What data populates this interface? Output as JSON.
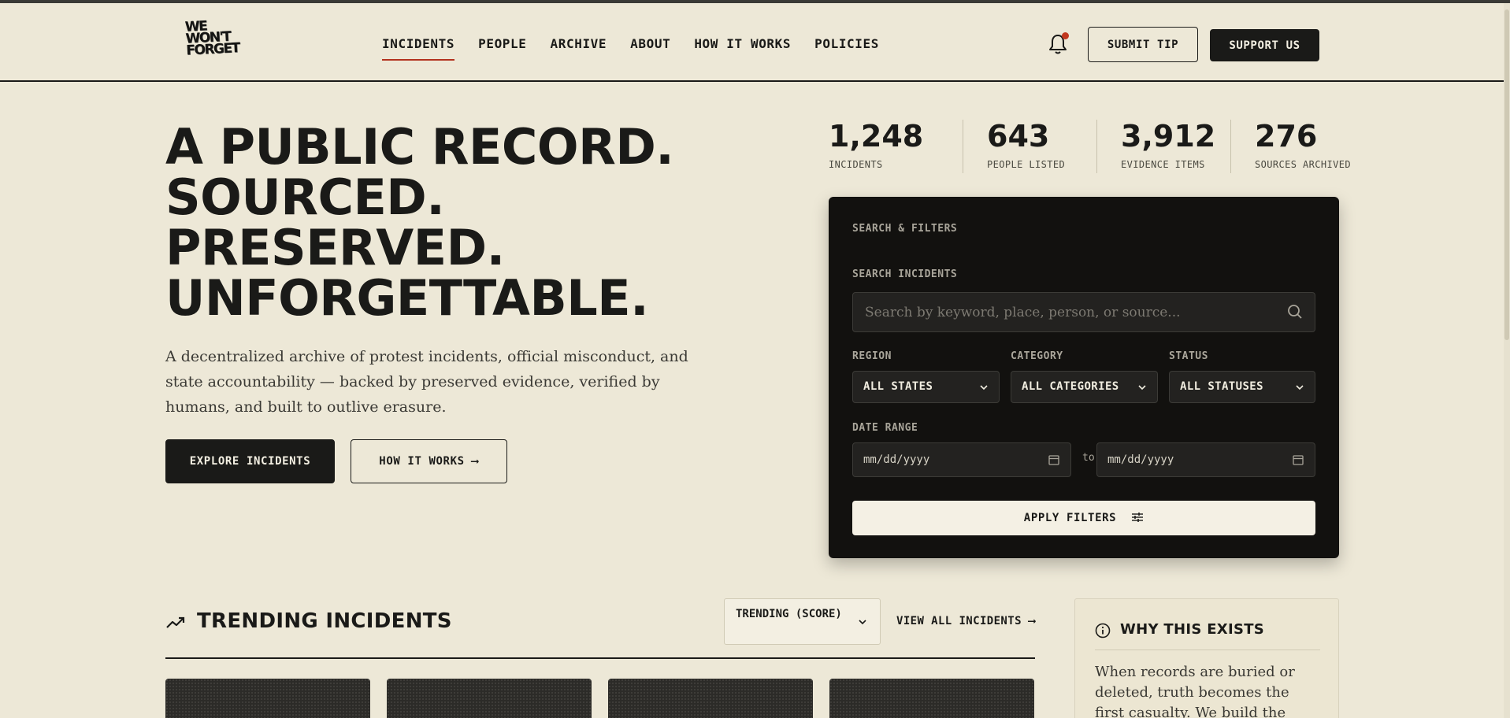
{
  "brand": {
    "logo_text": "WE WON'T FORGET"
  },
  "nav": {
    "items": [
      {
        "label": "INCIDENTS",
        "active": true
      },
      {
        "label": "PEOPLE"
      },
      {
        "label": "ARCHIVE"
      },
      {
        "label": "ABOUT"
      },
      {
        "label": "HOW IT WORKS"
      },
      {
        "label": "POLICIES"
      }
    ]
  },
  "header": {
    "notifications_icon": "bell-icon",
    "submit_tip_label": "SUBMIT TIP",
    "support_label": "SUPPORT US"
  },
  "hero": {
    "title_lines": [
      "A PUBLIC RECORD.",
      "SOURCED.",
      "PRESERVED.",
      "UNFORGETTABLE."
    ],
    "description": "A decentralized archive of protest incidents, official misconduct, and state accountability — backed by preserved evidence, verified by humans, and built to outlive erasure.",
    "explore_label": "EXPLORE INCIDENTS",
    "how_label": "HOW IT WORKS ⟶"
  },
  "stats": [
    {
      "value": "1,248",
      "label": "INCIDENTS"
    },
    {
      "value": "643",
      "label": "PEOPLE LISTED"
    },
    {
      "value": "3,912",
      "label": "EVIDENCE ITEMS"
    },
    {
      "value": "276",
      "label": "SOURCES ARCHIVED"
    }
  ],
  "filters": {
    "title": "SEARCH & FILTERS",
    "search_label": "SEARCH INCIDENTS",
    "search_placeholder": "Search by keyword, place, person, or source...",
    "region_label": "REGION",
    "region_value": "ALL STATES",
    "category_label": "CATEGORY",
    "category_value": "ALL CATEGORIES",
    "status_label": "STATUS",
    "status_value": "ALL STATUSES",
    "date_label": "DATE RANGE",
    "date_from": "mm/dd/yyyy",
    "date_to": "mm/dd/yyyy",
    "to_text": "to",
    "apply_label": "APPLY FILTERS"
  },
  "trending": {
    "title": "TRENDING INCIDENTS",
    "sort_value": "TRENDING (SCORE)",
    "view_all_label": "VIEW ALL INCIDENTS ⟶"
  },
  "why": {
    "title": "WHY THIS EXISTS",
    "text": "When records are buried or deleted, truth becomes the first casualty. We build the memory"
  },
  "colors": {
    "background": "#EDE8D7",
    "ink": "#1a1a18",
    "accent": "#b3321f",
    "panel": "#12110f"
  }
}
